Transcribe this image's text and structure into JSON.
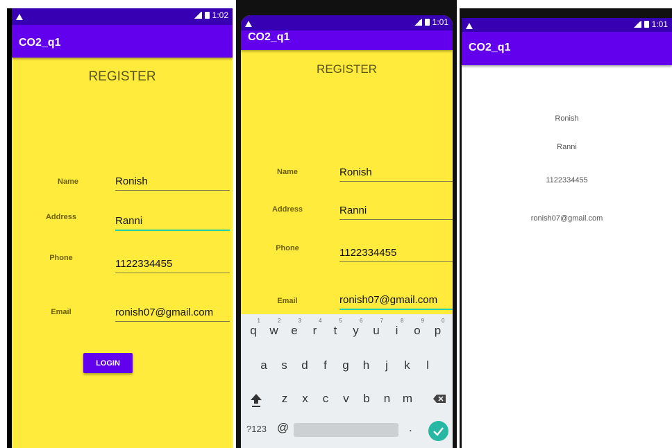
{
  "screens": [
    {
      "status_time": "1:02",
      "app_title": "CO2_q1",
      "heading": "REGISTER",
      "fields": [
        {
          "label": "Name",
          "value": "Ronish"
        },
        {
          "label": "Address",
          "value": "Ranni"
        },
        {
          "label": "Phone",
          "value": "1122334455"
        },
        {
          "label": "Email",
          "value": "ronish07@gmail.com"
        }
      ],
      "login_button": "LOGIN"
    },
    {
      "status_time": "1:01",
      "app_title": "CO2_q1",
      "heading": "REGISTER",
      "fields": [
        {
          "label": "Name",
          "value": "Ronish"
        },
        {
          "label": "Address",
          "value": "Ranni"
        },
        {
          "label": "Phone",
          "value": "1122334455"
        },
        {
          "label": "Email",
          "value": "ronish07@gmail.com"
        }
      ],
      "keyboard": {
        "row1": [
          "q",
          "w",
          "e",
          "r",
          "t",
          "y",
          "u",
          "i",
          "o",
          "p"
        ],
        "row1_numbers": [
          "1",
          "2",
          "3",
          "4",
          "5",
          "6",
          "7",
          "8",
          "9",
          "0"
        ],
        "row2": [
          "a",
          "s",
          "d",
          "f",
          "g",
          "h",
          "j",
          "k",
          "l"
        ],
        "row3": [
          "z",
          "x",
          "c",
          "v",
          "b",
          "n",
          "m"
        ],
        "symbols_key": "?123",
        "at_key": "@",
        "period_key": "."
      }
    },
    {
      "status_time": "1:01",
      "app_title": "CO2_q1",
      "results": [
        "Ronish",
        "Ranni",
        "1122334455",
        "ronish07@gmail.com"
      ]
    }
  ],
  "colors": {
    "primary": "#6200ee",
    "status_bar": "#3700b3",
    "form_bg": "#ffeb3b",
    "accent": "#26d0a8"
  }
}
